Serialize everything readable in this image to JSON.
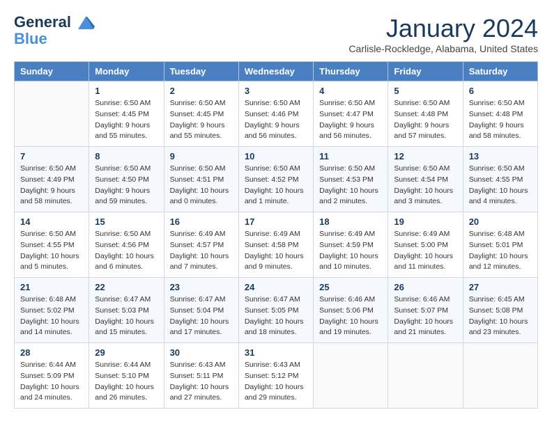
{
  "logo": {
    "line1": "General",
    "line2": "Blue"
  },
  "title": "January 2024",
  "location": "Carlisle-Rockledge, Alabama, United States",
  "weekdays": [
    "Sunday",
    "Monday",
    "Tuesday",
    "Wednesday",
    "Thursday",
    "Friday",
    "Saturday"
  ],
  "weeks": [
    [
      {
        "day": "",
        "sunrise": "",
        "sunset": "",
        "daylight": ""
      },
      {
        "day": "1",
        "sunrise": "Sunrise: 6:50 AM",
        "sunset": "Sunset: 4:45 PM",
        "daylight": "Daylight: 9 hours and 55 minutes."
      },
      {
        "day": "2",
        "sunrise": "Sunrise: 6:50 AM",
        "sunset": "Sunset: 4:45 PM",
        "daylight": "Daylight: 9 hours and 55 minutes."
      },
      {
        "day": "3",
        "sunrise": "Sunrise: 6:50 AM",
        "sunset": "Sunset: 4:46 PM",
        "daylight": "Daylight: 9 hours and 56 minutes."
      },
      {
        "day": "4",
        "sunrise": "Sunrise: 6:50 AM",
        "sunset": "Sunset: 4:47 PM",
        "daylight": "Daylight: 9 hours and 56 minutes."
      },
      {
        "day": "5",
        "sunrise": "Sunrise: 6:50 AM",
        "sunset": "Sunset: 4:48 PM",
        "daylight": "Daylight: 9 hours and 57 minutes."
      },
      {
        "day": "6",
        "sunrise": "Sunrise: 6:50 AM",
        "sunset": "Sunset: 4:48 PM",
        "daylight": "Daylight: 9 hours and 58 minutes."
      }
    ],
    [
      {
        "day": "7",
        "sunrise": "Sunrise: 6:50 AM",
        "sunset": "Sunset: 4:49 PM",
        "daylight": "Daylight: 9 hours and 58 minutes."
      },
      {
        "day": "8",
        "sunrise": "Sunrise: 6:50 AM",
        "sunset": "Sunset: 4:50 PM",
        "daylight": "Daylight: 9 hours and 59 minutes."
      },
      {
        "day": "9",
        "sunrise": "Sunrise: 6:50 AM",
        "sunset": "Sunset: 4:51 PM",
        "daylight": "Daylight: 10 hours and 0 minutes."
      },
      {
        "day": "10",
        "sunrise": "Sunrise: 6:50 AM",
        "sunset": "Sunset: 4:52 PM",
        "daylight": "Daylight: 10 hours and 1 minute."
      },
      {
        "day": "11",
        "sunrise": "Sunrise: 6:50 AM",
        "sunset": "Sunset: 4:53 PM",
        "daylight": "Daylight: 10 hours and 2 minutes."
      },
      {
        "day": "12",
        "sunrise": "Sunrise: 6:50 AM",
        "sunset": "Sunset: 4:54 PM",
        "daylight": "Daylight: 10 hours and 3 minutes."
      },
      {
        "day": "13",
        "sunrise": "Sunrise: 6:50 AM",
        "sunset": "Sunset: 4:55 PM",
        "daylight": "Daylight: 10 hours and 4 minutes."
      }
    ],
    [
      {
        "day": "14",
        "sunrise": "Sunrise: 6:50 AM",
        "sunset": "Sunset: 4:55 PM",
        "daylight": "Daylight: 10 hours and 5 minutes."
      },
      {
        "day": "15",
        "sunrise": "Sunrise: 6:50 AM",
        "sunset": "Sunset: 4:56 PM",
        "daylight": "Daylight: 10 hours and 6 minutes."
      },
      {
        "day": "16",
        "sunrise": "Sunrise: 6:49 AM",
        "sunset": "Sunset: 4:57 PM",
        "daylight": "Daylight: 10 hours and 7 minutes."
      },
      {
        "day": "17",
        "sunrise": "Sunrise: 6:49 AM",
        "sunset": "Sunset: 4:58 PM",
        "daylight": "Daylight: 10 hours and 9 minutes."
      },
      {
        "day": "18",
        "sunrise": "Sunrise: 6:49 AM",
        "sunset": "Sunset: 4:59 PM",
        "daylight": "Daylight: 10 hours and 10 minutes."
      },
      {
        "day": "19",
        "sunrise": "Sunrise: 6:49 AM",
        "sunset": "Sunset: 5:00 PM",
        "daylight": "Daylight: 10 hours and 11 minutes."
      },
      {
        "day": "20",
        "sunrise": "Sunrise: 6:48 AM",
        "sunset": "Sunset: 5:01 PM",
        "daylight": "Daylight: 10 hours and 12 minutes."
      }
    ],
    [
      {
        "day": "21",
        "sunrise": "Sunrise: 6:48 AM",
        "sunset": "Sunset: 5:02 PM",
        "daylight": "Daylight: 10 hours and 14 minutes."
      },
      {
        "day": "22",
        "sunrise": "Sunrise: 6:47 AM",
        "sunset": "Sunset: 5:03 PM",
        "daylight": "Daylight: 10 hours and 15 minutes."
      },
      {
        "day": "23",
        "sunrise": "Sunrise: 6:47 AM",
        "sunset": "Sunset: 5:04 PM",
        "daylight": "Daylight: 10 hours and 17 minutes."
      },
      {
        "day": "24",
        "sunrise": "Sunrise: 6:47 AM",
        "sunset": "Sunset: 5:05 PM",
        "daylight": "Daylight: 10 hours and 18 minutes."
      },
      {
        "day": "25",
        "sunrise": "Sunrise: 6:46 AM",
        "sunset": "Sunset: 5:06 PM",
        "daylight": "Daylight: 10 hours and 19 minutes."
      },
      {
        "day": "26",
        "sunrise": "Sunrise: 6:46 AM",
        "sunset": "Sunset: 5:07 PM",
        "daylight": "Daylight: 10 hours and 21 minutes."
      },
      {
        "day": "27",
        "sunrise": "Sunrise: 6:45 AM",
        "sunset": "Sunset: 5:08 PM",
        "daylight": "Daylight: 10 hours and 23 minutes."
      }
    ],
    [
      {
        "day": "28",
        "sunrise": "Sunrise: 6:44 AM",
        "sunset": "Sunset: 5:09 PM",
        "daylight": "Daylight: 10 hours and 24 minutes."
      },
      {
        "day": "29",
        "sunrise": "Sunrise: 6:44 AM",
        "sunset": "Sunset: 5:10 PM",
        "daylight": "Daylight: 10 hours and 26 minutes."
      },
      {
        "day": "30",
        "sunrise": "Sunrise: 6:43 AM",
        "sunset": "Sunset: 5:11 PM",
        "daylight": "Daylight: 10 hours and 27 minutes."
      },
      {
        "day": "31",
        "sunrise": "Sunrise: 6:43 AM",
        "sunset": "Sunset: 5:12 PM",
        "daylight": "Daylight: 10 hours and 29 minutes."
      },
      {
        "day": "",
        "sunrise": "",
        "sunset": "",
        "daylight": ""
      },
      {
        "day": "",
        "sunrise": "",
        "sunset": "",
        "daylight": ""
      },
      {
        "day": "",
        "sunrise": "",
        "sunset": "",
        "daylight": ""
      }
    ]
  ]
}
